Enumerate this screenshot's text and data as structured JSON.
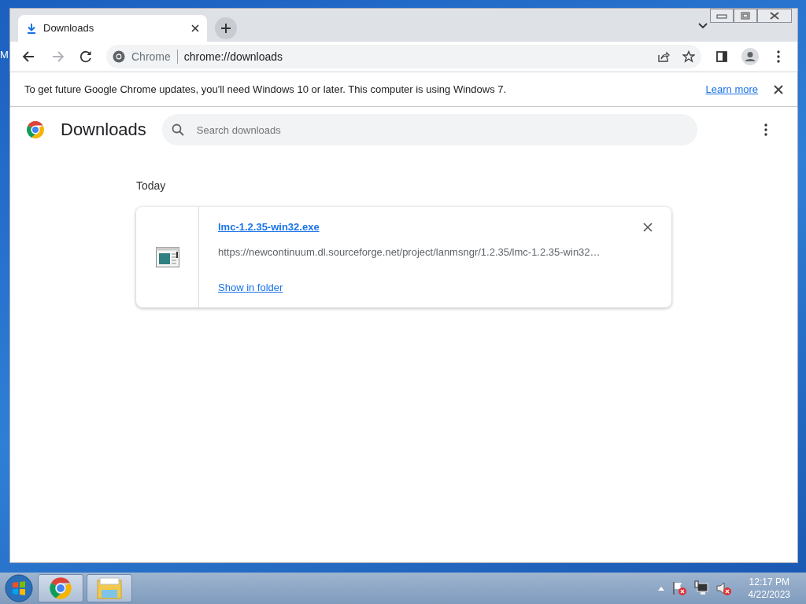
{
  "desktop": {
    "icon_label": "M"
  },
  "tabs": [
    {
      "label": "Downloads",
      "selected": true
    }
  ],
  "nav_buttons": [
    {
      "kind": "back",
      "disabled": false
    },
    {
      "kind": "forward",
      "disabled": true
    },
    {
      "kind": "reload",
      "disabled": false
    }
  ],
  "address_bar": {
    "site_label": "Chrome",
    "url": "chrome://downloads"
  },
  "infobar": {
    "message": "To get future Google Chrome updates, you'll need Windows 10 or later. This computer is using Windows 7.",
    "link": "Learn more"
  },
  "page": {
    "title": "Downloads",
    "search": {
      "placeholder": "Search downloads"
    },
    "section": "Today",
    "downloads": [
      {
        "file_name": "lmc-1.2.35-win32.exe",
        "url": "https://newcontinuum.dl.sourceforge.net/project/lanmsngr/1.2.35/lmc-1.2.35-win32…",
        "action": "Show in folder"
      }
    ]
  },
  "taskbar": {
    "apps": [
      {
        "kind": "chrome"
      },
      {
        "kind": "explorer"
      }
    ],
    "clock": {
      "time": "12:17 PM",
      "date": "4/22/2023"
    }
  }
}
